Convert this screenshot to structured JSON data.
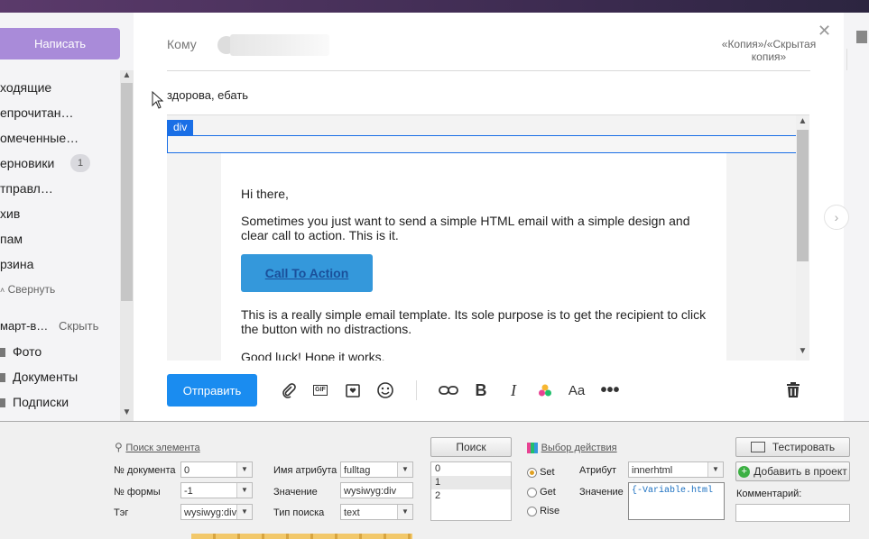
{
  "sidebar": {
    "compose_label": "Написать",
    "items": [
      {
        "label": "ходящие"
      },
      {
        "label": "епрочитан…"
      },
      {
        "label": "омеченные…"
      },
      {
        "label": "ерновики",
        "badge": "1"
      },
      {
        "label": "тправл…"
      },
      {
        "label": "хив"
      },
      {
        "label": "пам"
      },
      {
        "label": "рзина"
      }
    ],
    "collapse_label": "Свернуть",
    "smart_label": "март-в…",
    "hide_label": "Скрыть",
    "folders": [
      {
        "label": "Фото"
      },
      {
        "label": "Документы"
      },
      {
        "label": "Подписки"
      }
    ]
  },
  "compose": {
    "to_label": "Кому",
    "cc_label": "«Копия»/«Скрытая копия»",
    "subject": "здорова, ебать",
    "selected_tag": "div",
    "email": {
      "greeting": "Hi there,",
      "para1": "Sometimes you just want to send a simple HTML email with a simple design and clear call to action. This is it.",
      "cta": "Call To Action",
      "para2": "This is a really simple email template. Its sole purpose is to get the recipient to click the button with no distractions.",
      "para3": "Good luck! Hope it works."
    },
    "send_label": "Отправить",
    "toolbar_icons": [
      "paperclip-icon",
      "gif-icon",
      "postcard-icon",
      "emoji-icon",
      "link-icon",
      "bold-icon",
      "italic-icon",
      "color-icon",
      "font-size-icon",
      "more-icon",
      "trash-icon"
    ]
  },
  "panel": {
    "find_element_link": "Поиск элемента",
    "doc_num_label": "№ документа",
    "doc_num_value": "0",
    "form_num_label": "№ формы",
    "form_num_value": "-1",
    "tag_label": "Тэг",
    "tag_value": "wysiwyg:div",
    "attr_name_label": "Имя атрибута",
    "attr_name_value": "fulltag",
    "value_label": "Значение",
    "value_value": "wysiwyg:div",
    "search_type_label": "Тип поиска",
    "search_type_value": "text",
    "search_button": "Поиск",
    "results": [
      "0",
      "1",
      "2"
    ],
    "action_link": "Выбор действия",
    "radio_set": "Set",
    "radio_get": "Get",
    "radio_rise": "Rise",
    "attribute_label": "Атрибут",
    "attribute_value": "innerhtml",
    "value2_label": "Значение",
    "value2_text": "{-Variable.html",
    "test_button": "Тестировать",
    "add_button": "Добавить в проект",
    "comment_label": "Комментарий:"
  },
  "colors": {
    "compose_button": "#a98bd9",
    "send_button": "#1a8cf0",
    "cta_button": "#3498db",
    "selection": "#1a6fe6"
  }
}
